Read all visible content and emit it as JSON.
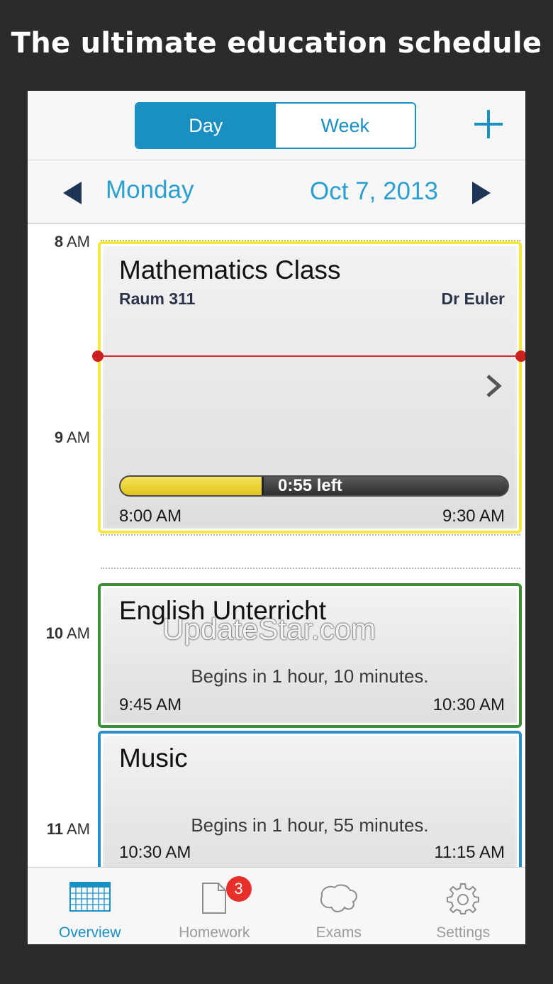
{
  "headline": "The ultimate education schedule",
  "header": {
    "segments": [
      {
        "label": "Day",
        "active": true
      },
      {
        "label": "Week",
        "active": false
      }
    ],
    "add_icon": "plus-icon"
  },
  "datebar": {
    "prev_icon": "triangle-left-icon",
    "next_icon": "triangle-right-icon",
    "day": "Monday",
    "date": "Oct 7, 2013"
  },
  "hours": [
    {
      "num": "8",
      "suffix": " AM"
    },
    {
      "num": "9",
      "suffix": " AM"
    },
    {
      "num": "10",
      "suffix": " AM"
    },
    {
      "num": "11",
      "suffix": " AM"
    }
  ],
  "events": [
    {
      "title": "Mathematics Class",
      "room": "Raum 311",
      "teacher": "Dr Euler",
      "start": "8:00 AM",
      "end": "9:30 AM",
      "progress_label": "0:55 left",
      "progress_fraction": 0.37,
      "color": "#f5e83a",
      "chevron_icon": "chevron-right-icon"
    },
    {
      "title": "English Unterricht",
      "begins": "Begins in 1 hour, 10 minutes.",
      "start": "9:45 AM",
      "end": "10:30 AM",
      "color": "#3e8e35"
    },
    {
      "title": "Music",
      "begins": "Begins in 1 hour, 55 minutes.",
      "start": "10:30 AM",
      "end": "11:15 AM",
      "color": "#2a8ec8"
    }
  ],
  "watermark": "UpdateStar.com",
  "tabs": [
    {
      "label": "Overview",
      "icon": "calendar-grid-icon",
      "active": true
    },
    {
      "label": "Homework",
      "icon": "document-icon",
      "badge": "3"
    },
    {
      "label": "Exams",
      "icon": "cloud-outline-icon"
    },
    {
      "label": "Settings",
      "icon": "gear-icon"
    }
  ],
  "colors": {
    "accent": "#1a8fc1",
    "now_line": "#d72a2a",
    "badge": "#e8302a"
  }
}
